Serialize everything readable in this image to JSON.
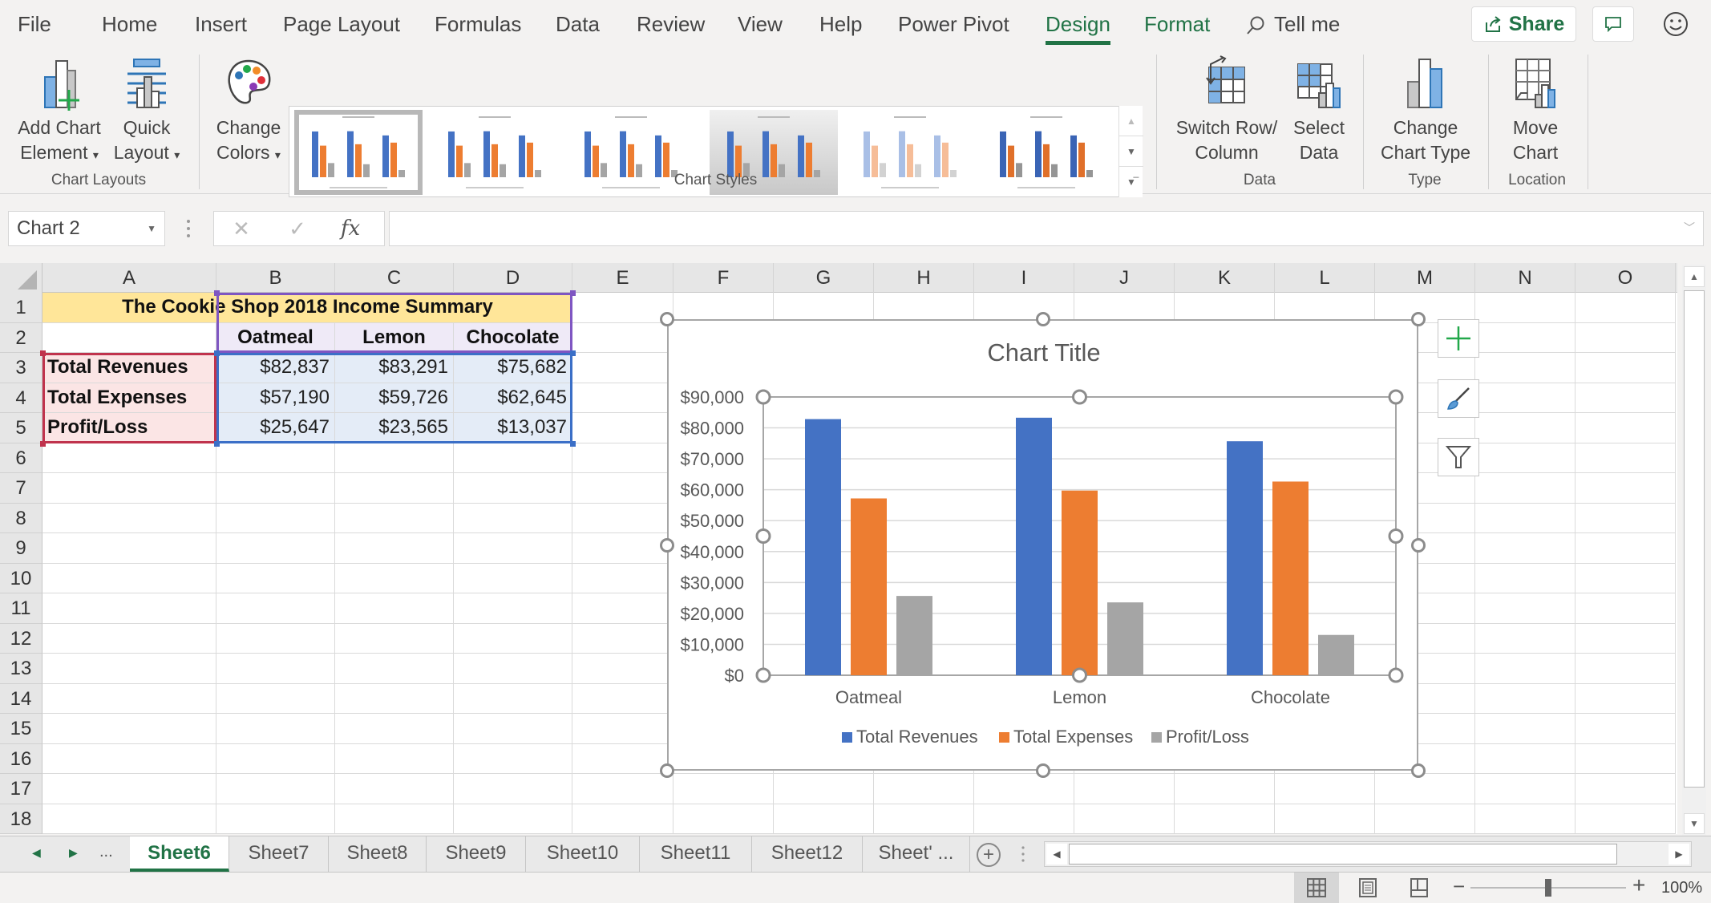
{
  "menu": {
    "tabs": [
      {
        "label": "File",
        "state": "normal"
      },
      {
        "label": "Home",
        "state": "normal"
      },
      {
        "label": "Insert",
        "state": "normal"
      },
      {
        "label": "Page Layout",
        "state": "normal"
      },
      {
        "label": "Formulas",
        "state": "normal"
      },
      {
        "label": "Data",
        "state": "normal"
      },
      {
        "label": "Review",
        "state": "normal"
      },
      {
        "label": "View",
        "state": "normal"
      },
      {
        "label": "Help",
        "state": "normal"
      },
      {
        "label": "Power Pivot",
        "state": "normal"
      },
      {
        "label": "Design",
        "state": "active"
      },
      {
        "label": "Format",
        "state": "contextual"
      }
    ],
    "tell_me": "Tell me",
    "share": "Share",
    "icons": {
      "search": "search-icon",
      "share": "share-icon",
      "comments": "comment-icon",
      "feedback": "smiley-icon"
    }
  },
  "ribbon": {
    "add_chart_element": {
      "line1": "Add Chart",
      "line2": "Element",
      "caret": "▾"
    },
    "quick_layout": {
      "line1": "Quick",
      "line2": "Layout",
      "caret": "▾"
    },
    "change_colors": {
      "line1": "Change",
      "line2": "Colors",
      "caret": "▾"
    },
    "switch_row_column": {
      "line1": "Switch Row/",
      "line2": "Column"
    },
    "select_data": {
      "line1": "Select",
      "line2": "Data"
    },
    "change_chart_type": {
      "line1": "Change",
      "line2": "Chart Type"
    },
    "move_chart": {
      "line1": "Move",
      "line2": "Chart"
    },
    "groups": {
      "chart_layouts": "Chart Layouts",
      "chart_styles": "Chart Styles",
      "data": "Data",
      "type": "Type",
      "location": "Location"
    },
    "chart_styles": [
      {
        "name": "Style 1",
        "selected": true
      },
      {
        "name": "Style 2",
        "selected": false
      },
      {
        "name": "Style 3",
        "selected": false
      },
      {
        "name": "Style 4",
        "selected": false
      },
      {
        "name": "Style 5",
        "selected": false
      },
      {
        "name": "Style 6",
        "selected": false
      }
    ],
    "collapse": "^"
  },
  "formula_bar": {
    "name_box": "Chart 2",
    "cancel": "✕",
    "enter": "✓",
    "fx": "fx",
    "formula": ""
  },
  "sheet": {
    "columns": [
      "A",
      "B",
      "C",
      "D",
      "E",
      "F",
      "G",
      "H",
      "I",
      "J",
      "K",
      "L",
      "M",
      "N",
      "O"
    ],
    "rows": [
      "1",
      "2",
      "3",
      "4",
      "5",
      "6",
      "7",
      "8",
      "9",
      "10",
      "11",
      "12",
      "13",
      "14",
      "15",
      "16",
      "17",
      "18"
    ],
    "title": "The Cookie Shop 2018 Income Summary",
    "headers": [
      "Oatmeal",
      "Lemon",
      "Chocolate"
    ],
    "data_rows": [
      {
        "label": "Total Revenues",
        "values": [
          "$82,837",
          "$83,291",
          "$75,682"
        ]
      },
      {
        "label": "Total Expenses",
        "values": [
          "$57,190",
          "$59,726",
          "$62,645"
        ]
      },
      {
        "label": "Profit/Loss",
        "values": [
          "$25,647",
          "$23,565",
          "$13,037"
        ]
      }
    ],
    "range_colors": {
      "series_names": "#c0334d",
      "categories": "#7f56c2",
      "values": "#3b6fc7",
      "title_fill": "#ffe699",
      "names_fill": "#fbe5e5",
      "cats_fill": "#efeaf7",
      "values_fill": "#e4ecf7"
    }
  },
  "chart_data": {
    "type": "bar",
    "title": "Chart Title",
    "categories": [
      "Oatmeal",
      "Lemon",
      "Chocolate"
    ],
    "series": [
      {
        "name": "Total Revenues",
        "color": "#4472c4",
        "values": [
          82837,
          83291,
          75682
        ]
      },
      {
        "name": "Total Expenses",
        "color": "#ed7d31",
        "values": [
          57190,
          59726,
          62645
        ]
      },
      {
        "name": "Profit/Loss",
        "color": "#a5a5a5",
        "values": [
          25647,
          23565,
          13037
        ]
      }
    ],
    "ylim": [
      0,
      90000
    ],
    "yticks": [
      0,
      10000,
      20000,
      30000,
      40000,
      50000,
      60000,
      70000,
      80000,
      90000
    ],
    "ytick_labels": [
      "$0",
      "$10,000",
      "$20,000",
      "$30,000",
      "$40,000",
      "$50,000",
      "$60,000",
      "$70,000",
      "$80,000",
      "$90,000"
    ],
    "xlabel": "",
    "ylabel": "",
    "grid": true,
    "legend": "bottom"
  },
  "chart_side_buttons": {
    "elements": "plus-icon",
    "styles": "brush-icon",
    "filters": "filter-icon"
  },
  "sheet_tabs": {
    "nav_prev": "◀",
    "nav_next": "▶",
    "more_left": "...",
    "tabs": [
      "Sheet6",
      "Sheet7",
      "Sheet8",
      "Sheet9",
      "Sheet10",
      "Sheet11",
      "Sheet12",
      "Sheet' ..."
    ],
    "active": "Sheet6",
    "add": "+"
  },
  "status_bar": {
    "zoom_level": "100%",
    "zoom_fraction": 0.5,
    "view": "normal"
  }
}
